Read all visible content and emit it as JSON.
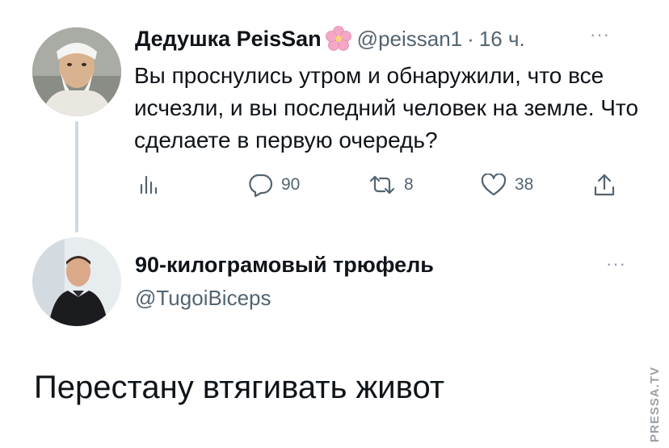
{
  "tweet1": {
    "display_name": "Дедушка PeisSan",
    "handle": "@peissan1",
    "separator": "·",
    "time": "16 ч.",
    "more": "···",
    "text": "Вы проснулись утром и обнаружили, что все исчезли, и вы последний человек на земле. Что сделаете в первую очередь?",
    "actions": {
      "analytics_icon": "analytics-icon",
      "reply_count": "90",
      "retweet_count": "8",
      "like_count": "38",
      "share_icon": "share-icon"
    }
  },
  "tweet2": {
    "display_name": "90-килограмовый трюфель",
    "handle": "@TugoiBiceps",
    "more": "···",
    "text": "Перестану втягивать живот"
  },
  "watermark": "PRESSA.TV",
  "colors": {
    "text": "#0f1419",
    "secondary": "#536471",
    "thread_line": "#cfd9de",
    "flower": "#f4a7c6"
  }
}
